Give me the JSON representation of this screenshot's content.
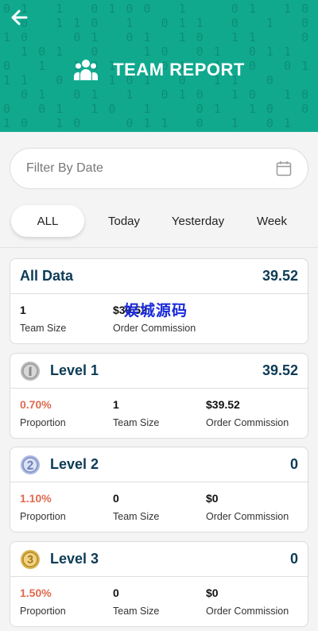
{
  "header": {
    "title": "TEAM REPORT",
    "background_color": "#10a98e",
    "back_icon": "arrow-left-icon",
    "title_icon": "team-icon"
  },
  "filter": {
    "placeholder": "Filter By Date",
    "icon": "calendar-icon"
  },
  "tabs": [
    {
      "label": "ALL",
      "active": true
    },
    {
      "label": "Today",
      "active": false
    },
    {
      "label": "Yesterday",
      "active": false
    },
    {
      "label": "Week",
      "active": false
    }
  ],
  "all_data": {
    "title": "All Data",
    "total": "39.52",
    "team_size_value": "1",
    "team_size_label": "Team Size",
    "commission_value": "$39.52",
    "commission_label": "Order Commission"
  },
  "levels": [
    {
      "title": "Level 1",
      "icon": "silver-medal-1-icon",
      "total": "39.52",
      "proportion": "0.70%",
      "proportion_label": "Proportion",
      "team_size": "1",
      "team_size_label": "Team Size",
      "commission": "$39.52",
      "commission_label": "Order Commission"
    },
    {
      "title": "Level 2",
      "icon": "blue-medal-2-icon",
      "total": "0",
      "proportion": "1.10%",
      "proportion_label": "Proportion",
      "team_size": "0",
      "team_size_label": "Team Size",
      "commission": "$0",
      "commission_label": "Order Commission"
    },
    {
      "title": "Level 3",
      "icon": "gold-medal-3-icon",
      "total": "0",
      "proportion": "1.50%",
      "proportion_label": "Proportion",
      "team_size": "0",
      "team_size_label": "Team Size",
      "commission": "$0",
      "commission_label": "Order Commission"
    }
  ],
  "watermark": "娱城源码",
  "colors": {
    "accent": "#10a98e",
    "title_navy": "#0c3b55",
    "proportion_red": "#e06a4f",
    "watermark_blue": "#1a2ad8"
  }
}
